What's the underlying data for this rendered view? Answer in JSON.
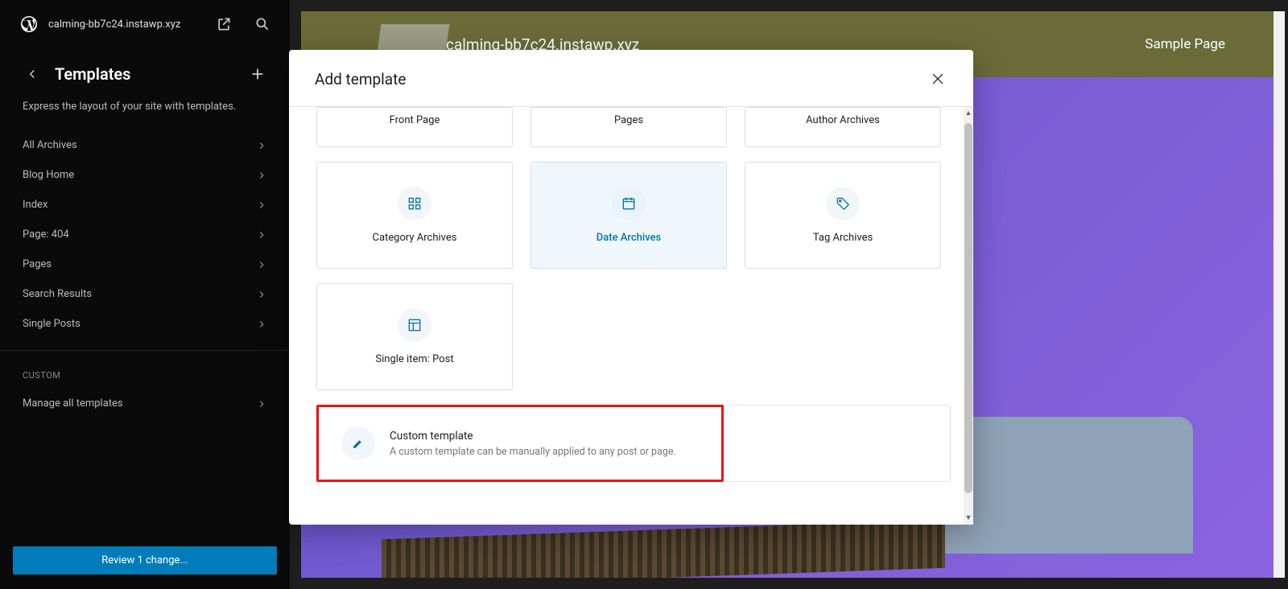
{
  "header": {
    "site_name": "calming-bb7c24.instawp.xyz"
  },
  "sidebar": {
    "title": "Templates",
    "description": "Express the layout of your site with templates.",
    "items": [
      {
        "label": "All Archives"
      },
      {
        "label": "Blog Home"
      },
      {
        "label": "Index"
      },
      {
        "label": "Page: 404"
      },
      {
        "label": "Pages"
      },
      {
        "label": "Search Results"
      },
      {
        "label": "Single Posts"
      }
    ],
    "custom_section_label": "Custom",
    "manage_label": "Manage all templates",
    "review_label": "Review 1 change..."
  },
  "preview": {
    "site_title": "calming-bb7c24.instawp.xyz",
    "nav_item": "Sample Page"
  },
  "modal": {
    "title": "Add template",
    "cards_row1": [
      {
        "label": "Front Page"
      },
      {
        "label": "Pages"
      },
      {
        "label": "Author Archives"
      }
    ],
    "cards_row2": [
      {
        "label": "Category Archives",
        "icon": "grid"
      },
      {
        "label": "Date Archives",
        "icon": "calendar",
        "active": true
      },
      {
        "label": "Tag Archives",
        "icon": "tag"
      }
    ],
    "cards_row3": [
      {
        "label": "Single item: Post",
        "icon": "layout"
      }
    ],
    "custom": {
      "title": "Custom template",
      "desc": "A custom template can be manually applied to any post or page."
    }
  }
}
